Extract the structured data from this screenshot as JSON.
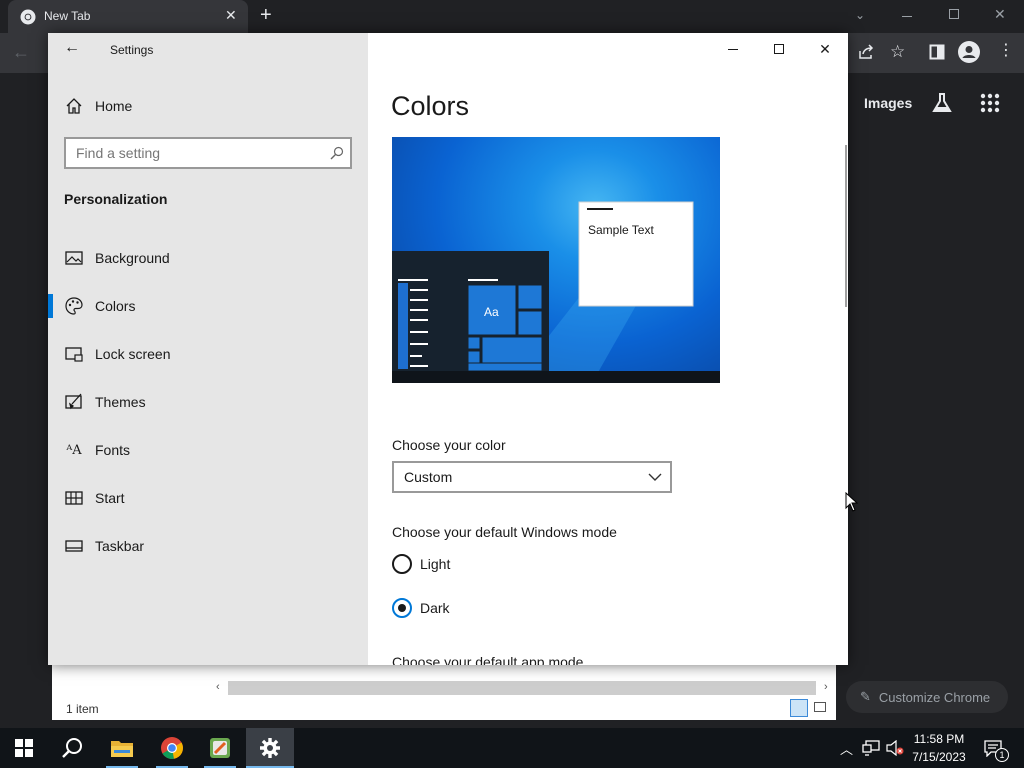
{
  "chrome": {
    "tab_title": "New Tab",
    "new_tab_symbol": "+",
    "images_link": "Images",
    "customize_label": "Customize Chrome",
    "icons": [
      "chrome-logo-icon",
      "back-icon",
      "share-icon",
      "star-icon",
      "side-panel-icon",
      "profile-icon",
      "more-icon",
      "labs-icon",
      "apps-icon",
      "pencil-icon"
    ]
  },
  "explorer": {
    "status": "1 item"
  },
  "settings": {
    "title": "Settings",
    "home_label": "Home",
    "search_placeholder": "Find a setting",
    "section_title": "Personalization",
    "nav": [
      {
        "label": "Background",
        "icon": "picture-icon"
      },
      {
        "label": "Colors",
        "icon": "palette-icon",
        "selected": true
      },
      {
        "label": "Lock screen",
        "icon": "lock-screen-icon"
      },
      {
        "label": "Themes",
        "icon": "paintbrush-icon"
      },
      {
        "label": "Fonts",
        "icon": "font-icon"
      },
      {
        "label": "Start",
        "icon": "start-icon"
      },
      {
        "label": "Taskbar",
        "icon": "taskbar-icon"
      }
    ],
    "page_title": "Colors",
    "preview": {
      "sample_text": "Sample Text",
      "tile_text": "Aa"
    },
    "choose_color_label": "Choose your color",
    "color_value": "Custom",
    "windows_mode_label": "Choose your default Windows mode",
    "mode_options": [
      "Light",
      "Dark"
    ],
    "mode_selected": "Dark",
    "app_mode_label": "Choose your default app mode"
  },
  "taskbar": {
    "time": "11:58 PM",
    "date": "7/15/2023",
    "notification_count": "1",
    "apps": [
      "start-icon",
      "search-icon",
      "file-explorer-icon",
      "chrome-icon",
      "app-icon",
      "settings-icon"
    ]
  },
  "colors": {
    "accent": "#0078d7",
    "sidebar_bg": "#e6e6e6",
    "chrome_dark": "#202124",
    "taskbar_bg": "#101418"
  }
}
